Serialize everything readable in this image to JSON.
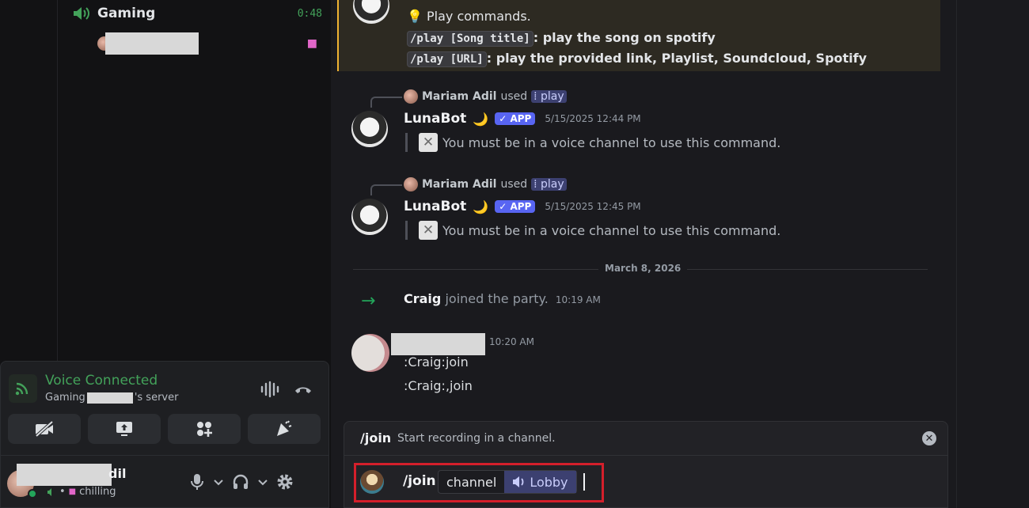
{
  "sidebar": {
    "voice_channel": {
      "name": "Gaming",
      "timer": "0:48"
    }
  },
  "voice_panel": {
    "status": "Voice Connected",
    "channel_prefix": "Gaming",
    "server_suffix": "'s server",
    "buttons": [
      "camera-off-icon",
      "screen-share-icon",
      "activities-icon",
      "soundboard-icon"
    ]
  },
  "user_bar": {
    "name_suffix": "dil",
    "status": "chilling"
  },
  "chat": {
    "bot_help": {
      "line1": "Play commands.",
      "line2_code": "/play [Song title]",
      "line2_text": ": play the song on spotify",
      "line3_code": "/play [URL]",
      "line3_text": ": play the provided link, Playlist, Soundcloud, Spotify"
    },
    "messages": [
      {
        "reply_user": "Mariam Adil",
        "reply_used": "used",
        "reply_cmd": "play",
        "author": "LunaBot",
        "author_emoji": "🌙",
        "badge": "APP",
        "timestamp": "5/15/2025 12:44 PM",
        "text": "You must be in a voice channel to use this command."
      },
      {
        "reply_user": "Mariam Adil",
        "reply_used": "used",
        "reply_cmd": "play",
        "author": "LunaBot",
        "author_emoji": "🌙",
        "badge": "APP",
        "timestamp": "5/15/2025 12:45 PM",
        "text": "You must be in a voice channel to use this command."
      }
    ],
    "date_divider": "March 8, 2026",
    "system_join": {
      "user": "Craig",
      "text": "joined the party.",
      "time": "10:19 AM"
    },
    "user_message": {
      "time": "10:20 AM",
      "lines": [
        ":Craig:join",
        ":Craig:,join"
      ]
    }
  },
  "autocomplete": {
    "command": "/join",
    "description": "Start recording in a channel."
  },
  "composer": {
    "command": "/join",
    "option_name": "channel",
    "option_value": "Lobby"
  },
  "colors": {
    "accent": "#5865f2",
    "voice_green": "#43a25a",
    "highlight_bar": "#f0b232",
    "red_box": "#d41f2b"
  }
}
